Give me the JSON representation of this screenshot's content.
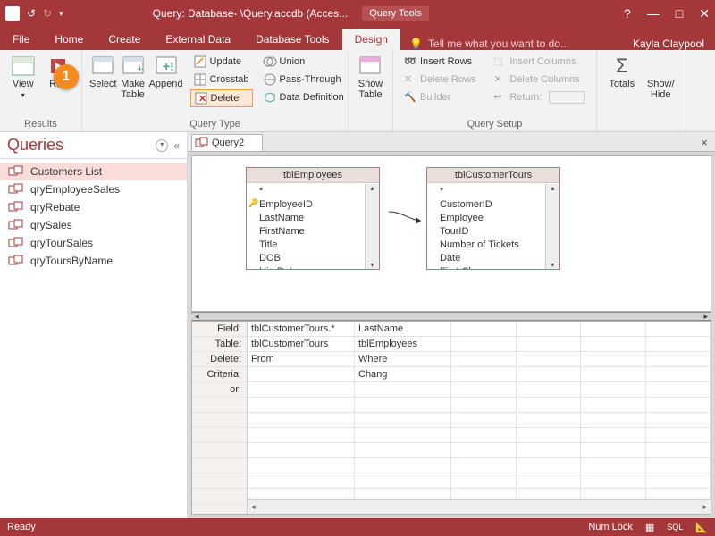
{
  "title": "Query: Database- \\Query.accdb (Acces...",
  "toolsTab": "Query Tools",
  "user": "Kayla Claypool",
  "tabs": [
    "File",
    "Home",
    "Create",
    "External Data",
    "Database Tools",
    "Design"
  ],
  "activeTab": "Design",
  "tellMe": "Tell me what you want to do...",
  "ribbon": {
    "results": {
      "view": "View",
      "run": "Run",
      "label": "Results"
    },
    "qtype": {
      "select": "Select",
      "make": "Make\nTable",
      "append": "Append",
      "update": "Update",
      "crosstab": "Crosstab",
      "delete": "Delete",
      "union": "Union",
      "pass": "Pass-Through",
      "datadef": "Data Definition",
      "label": "Query Type"
    },
    "show": {
      "show": "Show\nTable"
    },
    "setup": {
      "insrow": "Insert Rows",
      "delrow": "Delete Rows",
      "builder": "Builder",
      "inscol": "Insert Columns",
      "delcol": "Delete Columns",
      "ret": "Return:",
      "label": "Query Setup"
    },
    "sh": {
      "totals": "Totals",
      "hide": "Show/\nHide"
    }
  },
  "nav": {
    "title": "Queries",
    "items": [
      "Customers List",
      "qryEmployeeSales",
      "qryRebate",
      "qrySales",
      "qryTourSales",
      "qryToursByName"
    ],
    "selected": 0
  },
  "doc": {
    "tab": "Query2"
  },
  "tables": {
    "emp": {
      "name": "tblEmployees",
      "fields": [
        "*",
        "EmployeeID",
        "LastName",
        "FirstName",
        "Title",
        "DOB",
        "HireDate"
      ],
      "key": 1
    },
    "cust": {
      "name": "tblCustomerTours",
      "fields": [
        "*",
        "CustomerID",
        "Employee",
        "TourID",
        "Number of Tickets",
        "Date",
        "First Class"
      ]
    }
  },
  "grid": {
    "rows": [
      "Field:",
      "Table:",
      "Delete:",
      "Criteria:",
      "or:"
    ],
    "cols": [
      {
        "field": "tblCustomerTours.*",
        "table": "tblCustomerTours",
        "del": "From",
        "crit": ""
      },
      {
        "field": "LastName",
        "table": "tblEmployees",
        "del": "Where",
        "crit": "Chang"
      }
    ]
  },
  "status": {
    "ready": "Ready",
    "numlock": "Num Lock",
    "sql": "SQL"
  },
  "callout": "1"
}
